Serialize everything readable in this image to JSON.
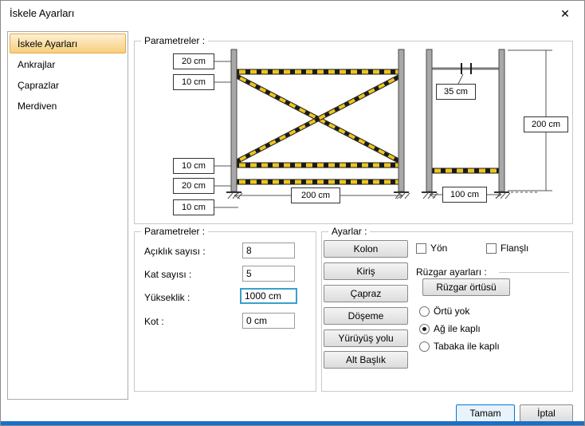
{
  "window": {
    "title": "İskele Ayarları",
    "close_glyph": "✕"
  },
  "sidebar": {
    "items": [
      {
        "label": "İskele Ayarları",
        "selected": true
      },
      {
        "label": "Ankrajlar",
        "selected": false
      },
      {
        "label": "Çaprazlar",
        "selected": false
      },
      {
        "label": "Merdiven",
        "selected": false
      }
    ]
  },
  "diagram_group": {
    "label": "Parametreler :"
  },
  "diagram": {
    "dims_left": [
      "20 cm",
      "10 cm",
      "10 cm",
      "20 cm",
      "10 cm"
    ],
    "span_label": "200 cm",
    "right_spacing": "35 cm",
    "right_height": "200 cm",
    "right_width": "100 cm"
  },
  "params_group": {
    "label": "Parametreler :",
    "fields": [
      {
        "label": "Açıklık sayısı :",
        "value": "8",
        "focused": false
      },
      {
        "label": "Kat sayısı :",
        "value": "5",
        "focused": false
      },
      {
        "label": "Yükseklik :",
        "value": "1000 cm",
        "focused": true
      },
      {
        "label": "Kot :",
        "value": "0 cm",
        "focused": false
      }
    ]
  },
  "settings_group": {
    "label": "Ayarlar :",
    "buttons": [
      "Kolon",
      "Kiriş",
      "Çapraz",
      "Döşeme",
      "Yürüyüş yolu",
      "Alt Başlık"
    ],
    "checkboxes": [
      {
        "label": "Yön",
        "checked": false
      },
      {
        "label": "Flanşlı",
        "checked": false
      }
    ],
    "wind": {
      "label": "Rüzgar ayarları :",
      "button": "Rüzgar örtüsü",
      "options": [
        {
          "label": "Örtü yok",
          "selected": false
        },
        {
          "label": "Ağ ile kaplı",
          "selected": true
        },
        {
          "label": "Tabaka ile kaplı",
          "selected": false
        }
      ]
    }
  },
  "footer": {
    "ok": "Tamam",
    "cancel": "İptal"
  },
  "colors": {
    "selected_item": "#F8CE7C",
    "focus_border": "#3AA0C9",
    "ok_border": "#0078D7",
    "bottom_bar": "#1A6FC8",
    "hazard_yellow": "#EDC51F"
  }
}
